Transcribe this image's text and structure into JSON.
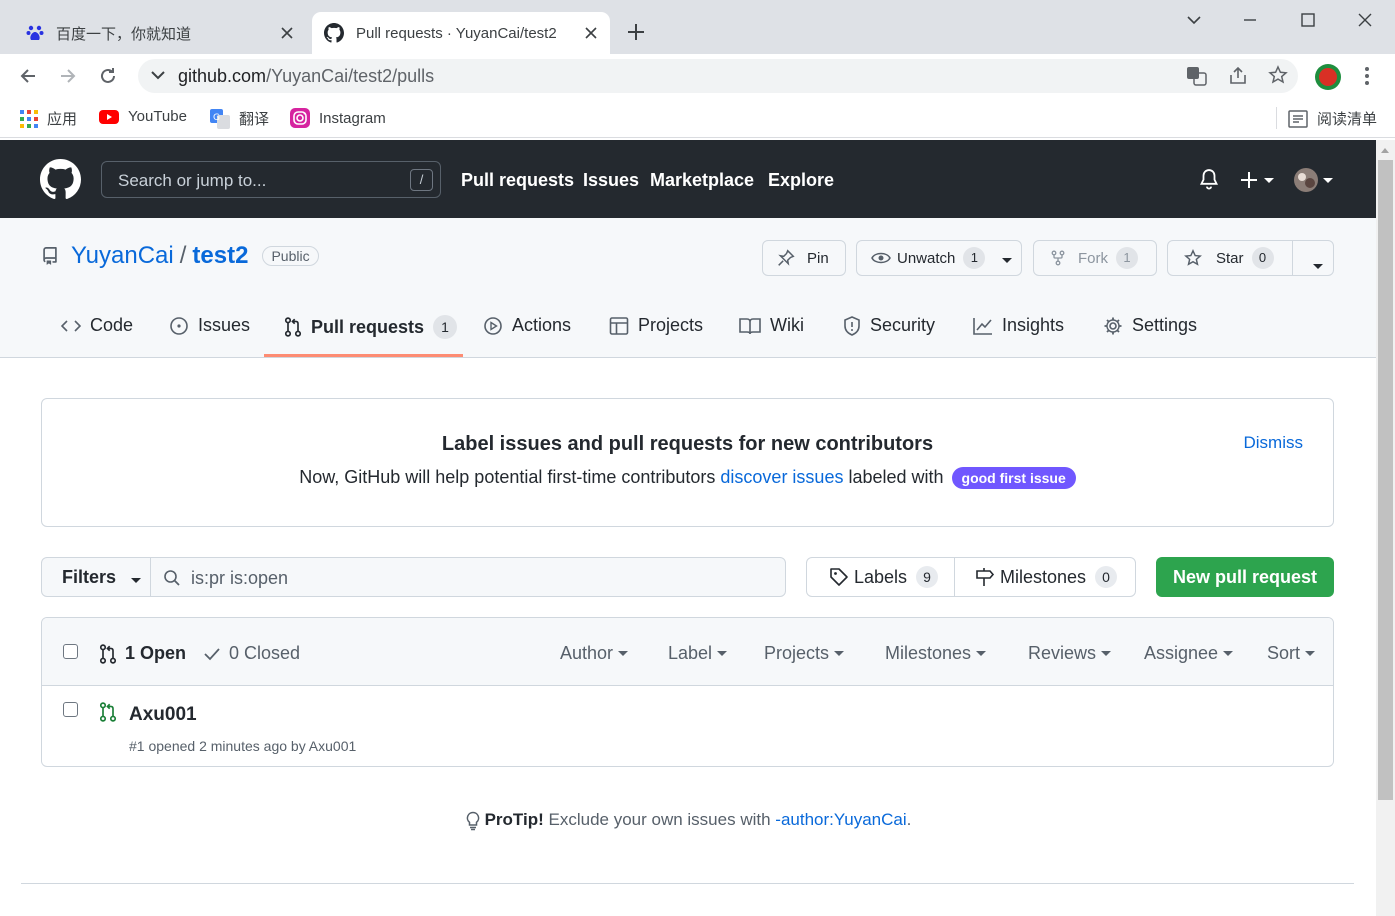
{
  "browser": {
    "tabs": [
      {
        "title": "百度一下，你就知道",
        "active": false
      },
      {
        "title": "Pull requests · YuyanCai/test2",
        "active": true
      }
    ],
    "url_host": "github.com",
    "url_path": "/YuyanCai/test2/pulls",
    "bookmarks": [
      {
        "label": "应用",
        "icon": "apps-grid-icon"
      },
      {
        "label": "YouTube",
        "icon": "youtube-icon"
      },
      {
        "label": "翻译",
        "icon": "translate-icon"
      },
      {
        "label": "Instagram",
        "icon": "instagram-icon"
      }
    ],
    "reading_list": "阅读清单"
  },
  "github_header": {
    "search_placeholder": "Search or jump to...",
    "search_shortcut": "/",
    "nav": [
      "Pull requests",
      "Issues",
      "Marketplace",
      "Explore"
    ]
  },
  "repo": {
    "owner": "YuyanCai",
    "separator": "/",
    "name": "test2",
    "visibility": "Public",
    "actions": {
      "pin": "Pin",
      "unwatch": "Unwatch",
      "unwatch_count": "1",
      "fork": "Fork",
      "fork_count": "1",
      "star": "Star",
      "star_count": "0"
    },
    "tabs": [
      {
        "label": "Code",
        "icon": "code-icon"
      },
      {
        "label": "Issues",
        "icon": "issue-icon"
      },
      {
        "label": "Pull requests",
        "icon": "pull-request-icon",
        "count": "1",
        "selected": true
      },
      {
        "label": "Actions",
        "icon": "play-icon"
      },
      {
        "label": "Projects",
        "icon": "table-icon"
      },
      {
        "label": "Wiki",
        "icon": "book-icon"
      },
      {
        "label": "Security",
        "icon": "shield-icon"
      },
      {
        "label": "Insights",
        "icon": "graph-icon"
      },
      {
        "label": "Settings",
        "icon": "gear-icon"
      }
    ]
  },
  "banner": {
    "title": "Label issues and pull requests for new contributors",
    "text_before": "Now, GitHub will help potential first-time contributors ",
    "link": "discover issues",
    "text_after": " labeled with ",
    "label_badge": "good first issue",
    "label_color": "#7057ff",
    "dismiss": "Dismiss"
  },
  "filter_bar": {
    "filters_label": "Filters",
    "query": "is:pr is:open",
    "labels": "Labels",
    "labels_count": "9",
    "milestones": "Milestones",
    "milestones_count": "0",
    "new_pr": "New pull request",
    "new_pr_color": "#2da44e"
  },
  "list": {
    "open": "1 Open",
    "closed": "0 Closed",
    "filters": [
      "Author",
      "Label",
      "Projects",
      "Milestones",
      "Reviews",
      "Assignee",
      "Sort"
    ],
    "items": [
      {
        "title": "Axu001",
        "meta": "#1 opened 2 minutes ago by Axu001"
      }
    ]
  },
  "protip": {
    "bold": "ProTip!",
    "text": " Exclude your own issues with ",
    "link": "-author:YuyanCai",
    "end": "."
  }
}
